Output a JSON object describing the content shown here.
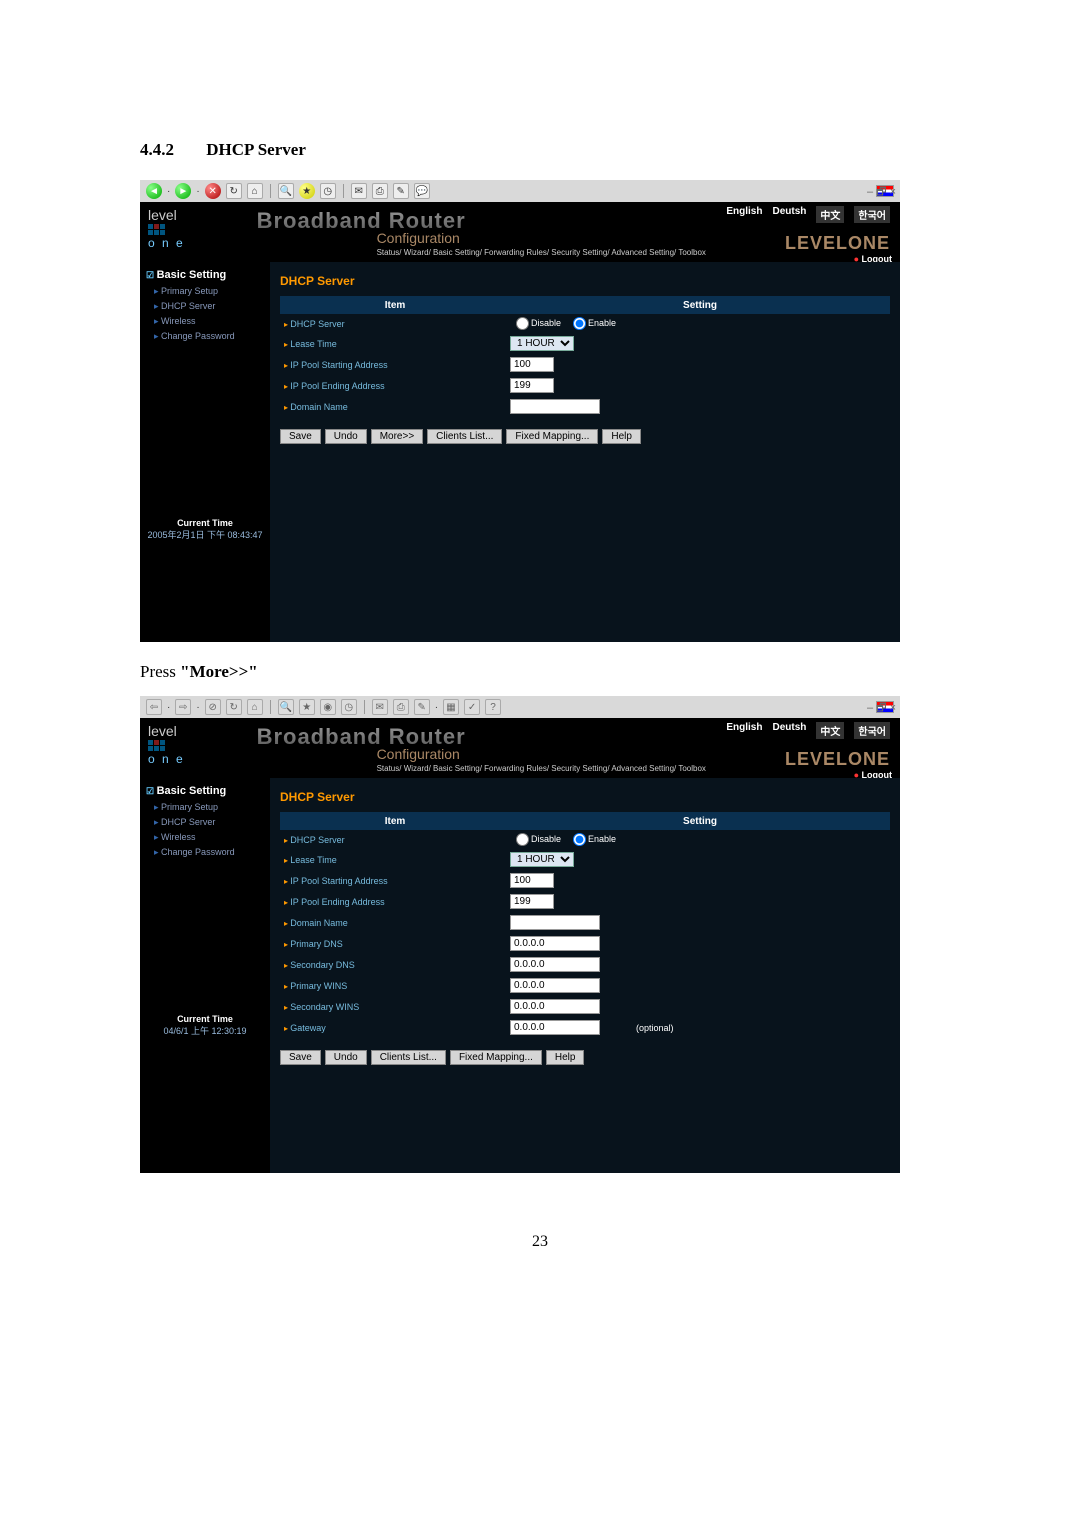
{
  "section": {
    "number": "4.4.2",
    "title": "DHCP Server"
  },
  "press_more": {
    "prefix": "Press ",
    "quoted": "\"More>>\""
  },
  "page_number": "23",
  "common": {
    "banner_title": "Broadband Router",
    "banner_sub": "Configuration",
    "breadcrumb": "Status/ Wizard/ Basic Setting/ Forwarding Rules/ Security Setting/ Advanced Setting/ Toolbox",
    "langs": {
      "en": "English",
      "de": "Deutsh",
      "zh": "中文",
      "ko": "한국어"
    },
    "logout": "Logout",
    "brand": "LEVELONE",
    "logo_level": "level",
    "logo_one": "o n e",
    "sidebar": {
      "group": "Basic Setting",
      "items": [
        "Primary Setup",
        "DHCP Server",
        "Wireless",
        "Change Password"
      ]
    },
    "panel_title": "DHCP Server",
    "cols": {
      "item": "Item",
      "setting": "Setting"
    },
    "current_time_label": "Current Time"
  },
  "shot1": {
    "current_time": "2005年2月1日 下午 08:43:47",
    "rows": {
      "dhcp": "DHCP Server",
      "lease": "Lease Time",
      "start": "IP Pool Starting Address",
      "end": "IP Pool Ending Address",
      "domain": "Domain Name"
    },
    "radio": {
      "disable": "Disable",
      "enable": "Enable"
    },
    "values": {
      "lease": "1 HOUR",
      "start": "100",
      "end": "199",
      "domain": ""
    },
    "buttons": {
      "save": "Save",
      "undo": "Undo",
      "more": "More>>",
      "clients": "Clients List...",
      "fixed": "Fixed Mapping...",
      "help": "Help"
    },
    "window_controls": "– 🗗 ×"
  },
  "shot2": {
    "current_time": "04/6/1 上午 12:30:19",
    "rows": {
      "dhcp": "DHCP Server",
      "lease": "Lease Time",
      "start": "IP Pool Starting Address",
      "end": "IP Pool Ending Address",
      "domain": "Domain Name",
      "pdns": "Primary DNS",
      "sdns": "Secondary DNS",
      "pwins": "Primary WINS",
      "swins": "Secondary WINS",
      "gw": "Gateway"
    },
    "radio": {
      "disable": "Disable",
      "enable": "Enable"
    },
    "values": {
      "lease": "1 HOUR",
      "start": "100",
      "end": "199",
      "domain": "",
      "pdns": "0.0.0.0",
      "sdns": "0.0.0.0",
      "pwins": "0.0.0.0",
      "swins": "0.0.0.0",
      "gw": "0.0.0.0"
    },
    "optional": "(optional)",
    "buttons": {
      "save": "Save",
      "undo": "Undo",
      "clients": "Clients List...",
      "fixed": "Fixed Mapping...",
      "help": "Help"
    },
    "window_controls": "– 🗗 ×"
  }
}
